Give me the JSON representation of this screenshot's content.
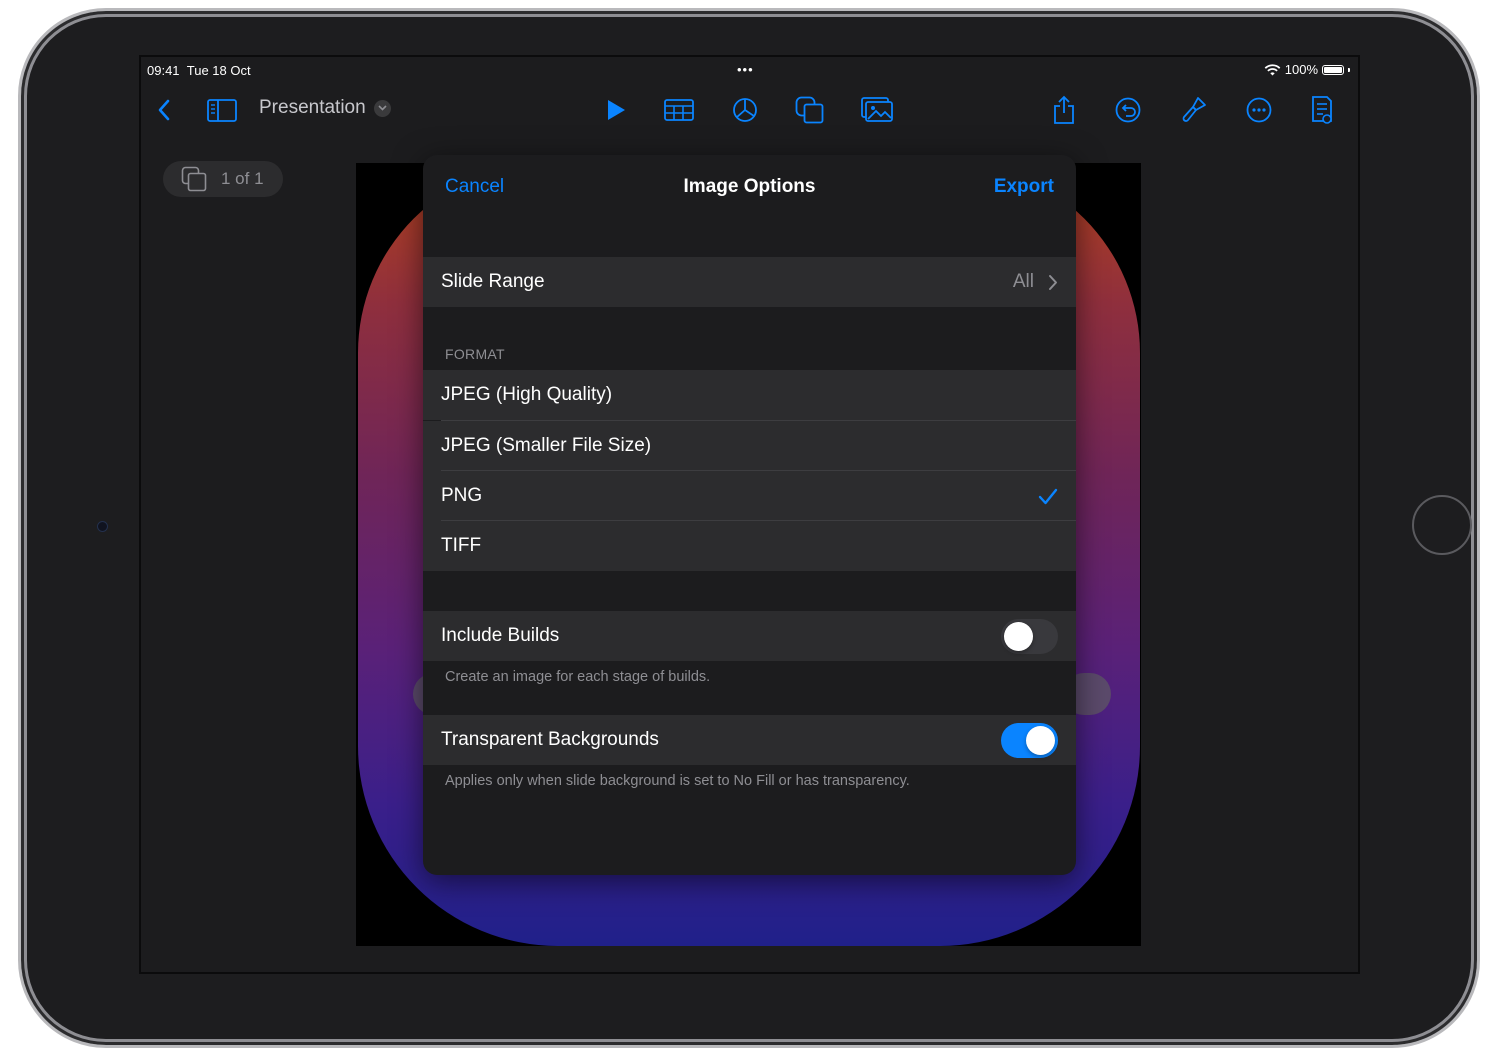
{
  "status_bar": {
    "time": "09:41",
    "date": "Tue 18 Oct",
    "multitask_dots": "•••",
    "battery": "100%"
  },
  "toolbar": {
    "document_title": "Presentation",
    "buttons": [
      "back",
      "sidebar",
      "play",
      "table",
      "chart",
      "shapes",
      "media",
      "share",
      "undo",
      "format",
      "more",
      "document"
    ]
  },
  "canvas": {
    "slide_counter": "1 of 1"
  },
  "modal": {
    "cancel_label": "Cancel",
    "title": "Image Options",
    "export_label": "Export",
    "slide_range": {
      "label": "Slide Range",
      "value": "All"
    },
    "format": {
      "section_label": "FORMAT",
      "options": [
        {
          "label": "JPEG (High Quality)",
          "selected": false
        },
        {
          "label": "JPEG (Smaller File Size)",
          "selected": false
        },
        {
          "label": "PNG",
          "selected": true
        },
        {
          "label": "TIFF",
          "selected": false
        }
      ]
    },
    "include_builds": {
      "label": "Include Builds",
      "on": false,
      "footnote": "Create an image for each stage of builds."
    },
    "transparent_backgrounds": {
      "label": "Transparent Backgrounds",
      "on": true,
      "footnote": "Applies only when slide background is set to No Fill or has transparency."
    }
  },
  "colors": {
    "accent": "#0a84ff",
    "toolbar_icon": "#0a84ff",
    "screen_bg": "#1c1c1e",
    "row_bg": "#2c2c2e"
  }
}
